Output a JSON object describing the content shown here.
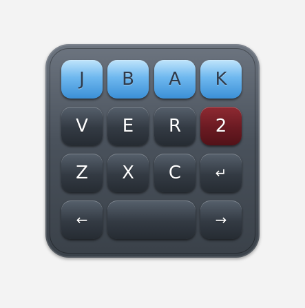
{
  "keyboard": {
    "row1": [
      "J",
      "B",
      "A",
      "K"
    ],
    "row2": [
      "V",
      "E",
      "R",
      "2"
    ],
    "row3": [
      "Z",
      "X",
      "C",
      "↵"
    ],
    "row4": {
      "left": "←",
      "space": "",
      "right": "→"
    }
  },
  "colors": {
    "accent_blue": "#6fb8ef",
    "key_dark": "#333a43",
    "key_red": "#6a1a22",
    "background": "#f3f3f3"
  }
}
